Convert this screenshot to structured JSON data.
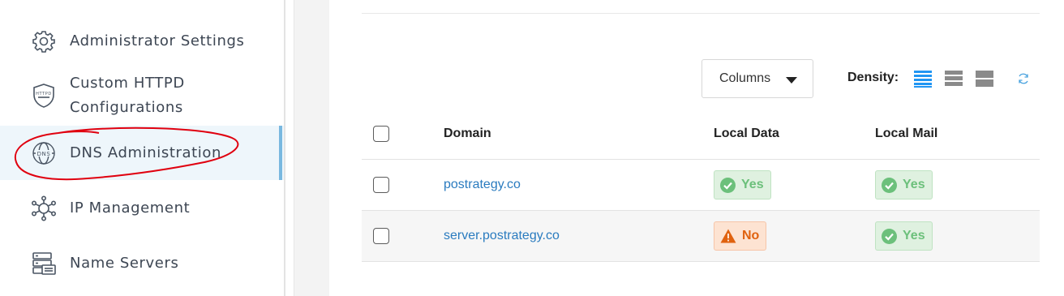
{
  "sidebar": {
    "items": [
      {
        "label": "Administrator Settings",
        "icon": "gear-icon"
      },
      {
        "label": "Custom HTTPD\nConfigurations",
        "icon": "httpd-shield-icon"
      },
      {
        "label": "DNS Administration",
        "icon": "dns-globe-icon",
        "active": true
      },
      {
        "label": "IP Management",
        "icon": "network-hub-icon"
      },
      {
        "label": "Name Servers",
        "icon": "server-stack-icon"
      }
    ]
  },
  "toolbar": {
    "columns_label": "Columns",
    "density_label": "Density:"
  },
  "table": {
    "headers": [
      "Domain",
      "Local Data",
      "Local Mail"
    ],
    "rows": [
      {
        "domain": "postrategy.co",
        "local_data": "Yes",
        "local_mail": "Yes"
      },
      {
        "domain": "server.postrategy.co",
        "local_data": "No",
        "local_mail": "Yes"
      }
    ]
  },
  "colors": {
    "link": "#2a7bbf",
    "yes_text": "#6cc07b",
    "no_text": "#e0620f",
    "active_bar": "#79b8e0",
    "annotation": "#e0000f"
  }
}
